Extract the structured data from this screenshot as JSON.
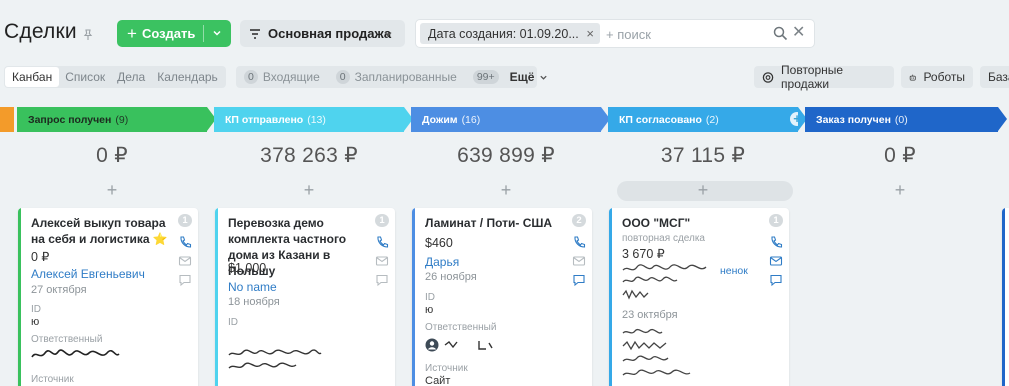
{
  "header": {
    "title": "Сделки",
    "create_label": "Создать",
    "pipeline_label": "Основная продажа",
    "filter_chip": "Дата создания: 01.09.20...",
    "search_placeholder": "+ поиск"
  },
  "views": [
    "Канбан",
    "Список",
    "Дела",
    "Календарь"
  ],
  "counters": [
    {
      "num": "0",
      "label": "Входящие"
    },
    {
      "num": "0",
      "label": "Запланированные"
    },
    {
      "num": "99+",
      "label": "Ещё"
    }
  ],
  "right_buttons": {
    "repeat_sales": "Повторные продажи",
    "robots": "Роботы",
    "base": "База"
  },
  "stages": [
    {
      "name": "Запрос получен",
      "count": "(9)",
      "color": "#39c15d",
      "sum": "0 ₽"
    },
    {
      "name": "КП отправлено",
      "count": "(13)",
      "color": "#4fd3ee",
      "sum": "378 263 ₽"
    },
    {
      "name": "Дожим",
      "count": "(16)",
      "color": "#4d8ee3",
      "sum": "639 899 ₽"
    },
    {
      "name": "КП согласовано",
      "count": "(2)",
      "color": "#35a9e8",
      "sum": "37 115 ₽"
    },
    {
      "name": "Заказ получен",
      "count": "(0)",
      "color": "#1f66c9",
      "sum": "0 ₽"
    }
  ],
  "cards": [
    {
      "title": "Алексей выкуп товара на себя и логистика ⭐",
      "badge": "1",
      "price": "0 ₽",
      "person": "Алексей Евгеньевич",
      "date": "27 октября",
      "id_label": "ID",
      "id_value": "ю",
      "resp_label": "Ответственный",
      "source_label": "Источник"
    },
    {
      "title": "Перевозка демо комплекта частного дома из Казани в Польшу",
      "badge": "1",
      "price": "$1,000",
      "person": "No name",
      "date": "18 ноября",
      "id_label": "ID"
    },
    {
      "title": "Ламинат / Поти- США",
      "badge": "2",
      "price": "$460",
      "person": "Дарья",
      "date": "26 ноября",
      "id_label": "ID",
      "id_value": "ю",
      "resp_label": "Ответственный",
      "source_label": "Источник",
      "source_value": "Сайт"
    },
    {
      "title": "ООО \"МСГ\"",
      "badge": "1",
      "subtitle": "повторная сделка",
      "price": "3 670 ₽",
      "person_tail": "ненок",
      "date": "23 октября"
    }
  ]
}
